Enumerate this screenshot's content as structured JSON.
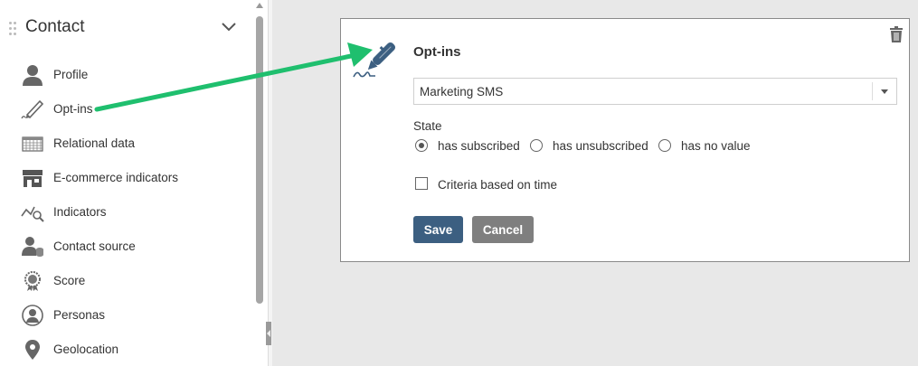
{
  "sidebar": {
    "title": "Contact",
    "items": [
      {
        "label": "Profile",
        "icon": "person-icon"
      },
      {
        "label": "Opt-ins",
        "icon": "pen-icon"
      },
      {
        "label": "Relational data",
        "icon": "table-icon"
      },
      {
        "label": "E-commerce indicators",
        "icon": "store-icon"
      },
      {
        "label": "Indicators",
        "icon": "chart-magnifier-icon"
      },
      {
        "label": "Contact source",
        "icon": "person-database-icon"
      },
      {
        "label": "Score",
        "icon": "medal-icon"
      },
      {
        "label": "Personas",
        "icon": "persona-icon"
      },
      {
        "label": "Geolocation",
        "icon": "map-pin-icon"
      }
    ]
  },
  "card": {
    "title": "Opt-ins",
    "select_value": "Marketing SMS",
    "state_label": "State",
    "state_options": [
      {
        "label": "has subscribed",
        "selected": true
      },
      {
        "label": "has unsubscribed",
        "selected": false
      },
      {
        "label": "has no value",
        "selected": false
      }
    ],
    "criteria_label": "Criteria based on time",
    "criteria_checked": false,
    "save_label": "Save",
    "cancel_label": "Cancel"
  },
  "colors": {
    "save_button": "#3c5f81",
    "cancel_button": "#7f7f7f",
    "arrow": "#1fbf6e",
    "icon_dark": "#555555",
    "pen_blue": "#3c5f81"
  }
}
